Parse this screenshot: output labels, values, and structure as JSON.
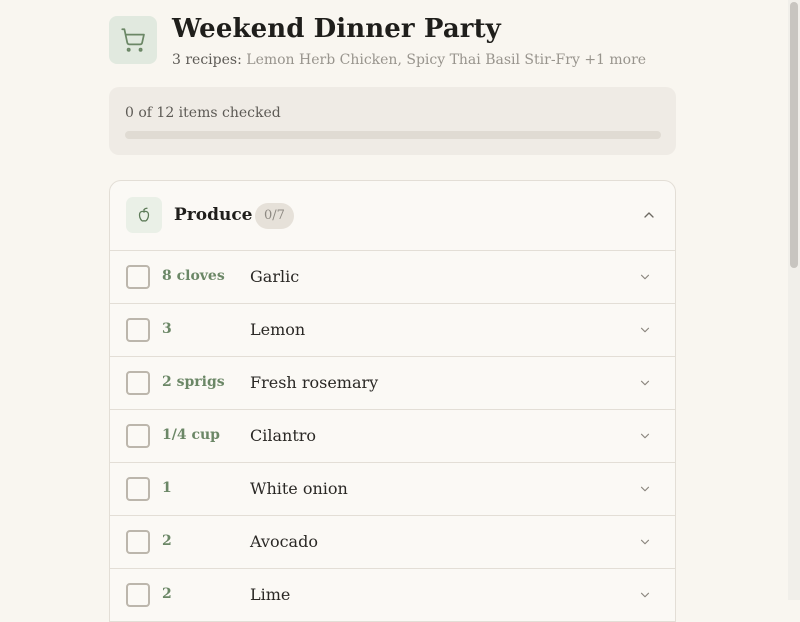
{
  "header": {
    "title": "Weekend Dinner Party",
    "recipe_count": "3 recipes:",
    "recipe_list": "Lemon Herb Chicken, Spicy Thai Basil Stir-Fry +1 more",
    "icon": "cart-icon"
  },
  "progress": {
    "text": "0 of 12 items checked",
    "checked": 0,
    "total": 12,
    "fraction": 0.0
  },
  "section": {
    "title": "Produce",
    "count": "0/7",
    "icon": "apple-icon",
    "items": [
      {
        "qty": "8 cloves",
        "name": "Garlic"
      },
      {
        "qty": "3",
        "name": "Lemon"
      },
      {
        "qty": "2 sprigs",
        "name": "Fresh rosemary"
      },
      {
        "qty": "1/4 cup",
        "name": "Cilantro"
      },
      {
        "qty": "1",
        "name": "White onion"
      },
      {
        "qty": "2",
        "name": "Avocado"
      },
      {
        "qty": "2",
        "name": "Lime"
      }
    ]
  },
  "colors": {
    "background": "#f9f6f0",
    "accent": "#6b8766",
    "card": "#efebe5"
  }
}
